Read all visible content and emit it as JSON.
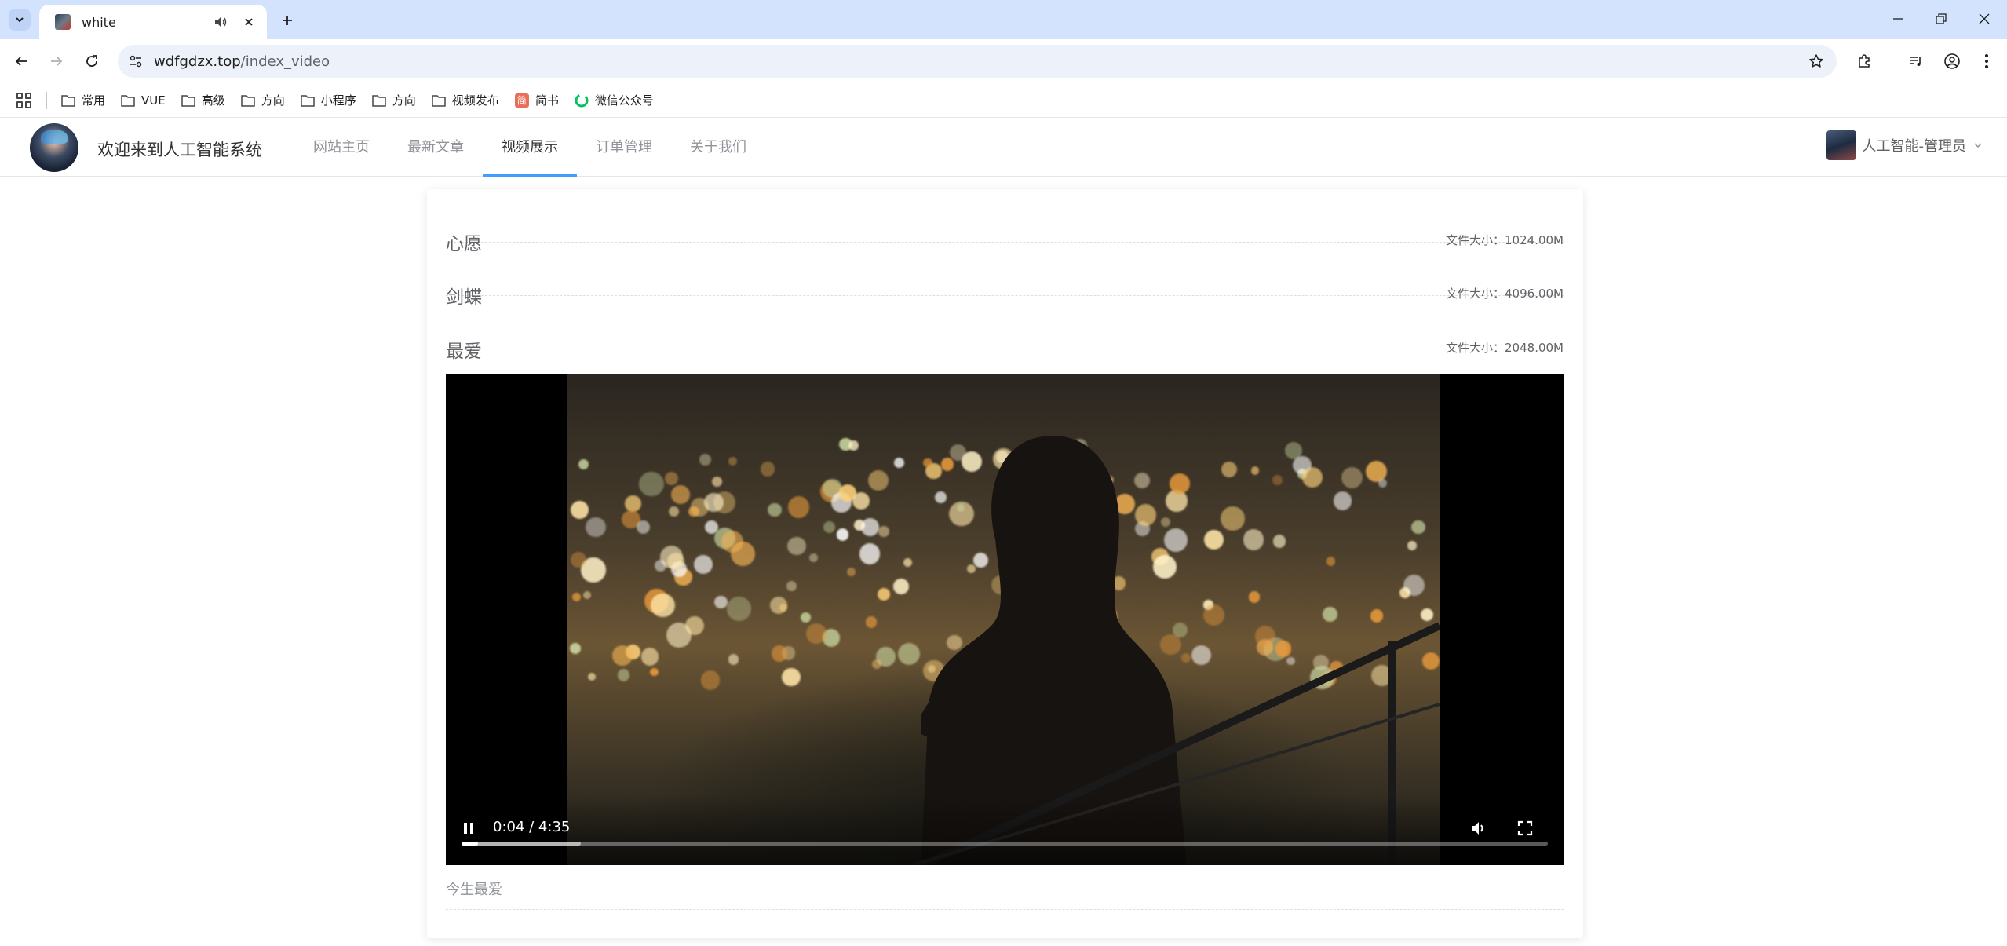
{
  "browser": {
    "tab": {
      "title": "white"
    },
    "url": {
      "host": "wdfgdzx.top",
      "path": "/index_video"
    },
    "bookmarks": [
      {
        "label": "常用",
        "icon": "folder-icon"
      },
      {
        "label": "VUE",
        "icon": "folder-icon"
      },
      {
        "label": "高级",
        "icon": "folder-icon"
      },
      {
        "label": "方向",
        "icon": "folder-icon"
      },
      {
        "label": "小程序",
        "icon": "folder-icon"
      },
      {
        "label": "方向",
        "icon": "folder-icon"
      },
      {
        "label": "视频发布",
        "icon": "folder-icon"
      },
      {
        "label": "简书",
        "icon": "jianshu-icon",
        "icon_text": "简"
      },
      {
        "label": "微信公众号",
        "icon": "wechat-icon"
      }
    ]
  },
  "site": {
    "title": "欢迎来到人工智能系统",
    "menu": [
      {
        "label": "网站主页"
      },
      {
        "label": "最新文章"
      },
      {
        "label": "视频展示",
        "active": true
      },
      {
        "label": "订单管理"
      },
      {
        "label": "关于我们"
      }
    ],
    "user": {
      "name": "人工智能-管理员"
    }
  },
  "videos": [
    {
      "title": "心愿",
      "size": "文件大小：1024.00M"
    },
    {
      "title": "剑蝶",
      "size": "文件大小：4096.00M"
    },
    {
      "title": "最爱",
      "size": "文件大小：2048.00M"
    }
  ],
  "player": {
    "time": "0:04 / 4:35",
    "buffered_fraction": 0.11,
    "played_fraction": 0.015
  },
  "description": "今生最爱",
  "colors": {
    "tabstrip": "#d3e3fd",
    "active_menu_underline": "#409eff",
    "muted_text": "#909399"
  }
}
